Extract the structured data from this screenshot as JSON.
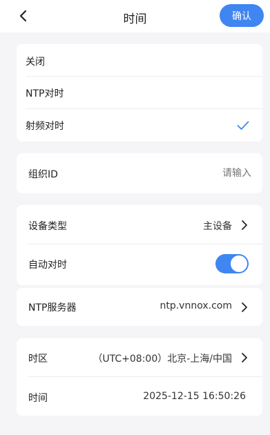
{
  "header": {
    "title": "时间",
    "confirm_label": "确认"
  },
  "sync_mode": {
    "options": [
      {
        "label": "关闭",
        "selected": false
      },
      {
        "label": "NTP对时",
        "selected": false
      },
      {
        "label": "射频对时",
        "selected": true
      }
    ]
  },
  "org": {
    "label": "组织ID",
    "placeholder": "请输入"
  },
  "device": {
    "type_label": "设备类型",
    "type_value": "主设备",
    "auto_sync_label": "自动对时",
    "auto_sync_on": true
  },
  "ntp": {
    "label": "NTP服务器",
    "value": "ntp.vnnox.com"
  },
  "time": {
    "zone_label": "时区",
    "zone_value": "（UTC+08:00）北京-上海/中国",
    "time_label": "时间",
    "time_value": "2025-12-15 16:50:26"
  },
  "colors": {
    "accent": "#3f86f3",
    "background": "#f5f5f7"
  }
}
